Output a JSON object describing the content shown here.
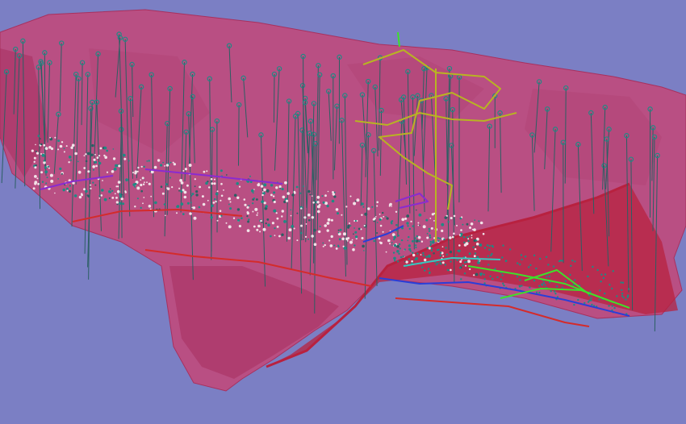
{
  "scene": {
    "background_color": "#7b7fc4",
    "orebody_color": "#c2497a",
    "orebody_shade_color": "#a8305e",
    "fault_plane_color": "#b8213f",
    "drillhole_color": "#2b5f63",
    "drillhole_node_color": "#1f8a84",
    "sample_point_color": "#f2e3e8",
    "underground_workings": {
      "purple_color": "#8a2bd0",
      "yellow_color": "#b8b422",
      "red_color": "#d42b2b",
      "blue_color": "#2a3ed8",
      "green_color": "#3ee02a",
      "cyan_color": "#38c8c0"
    }
  }
}
